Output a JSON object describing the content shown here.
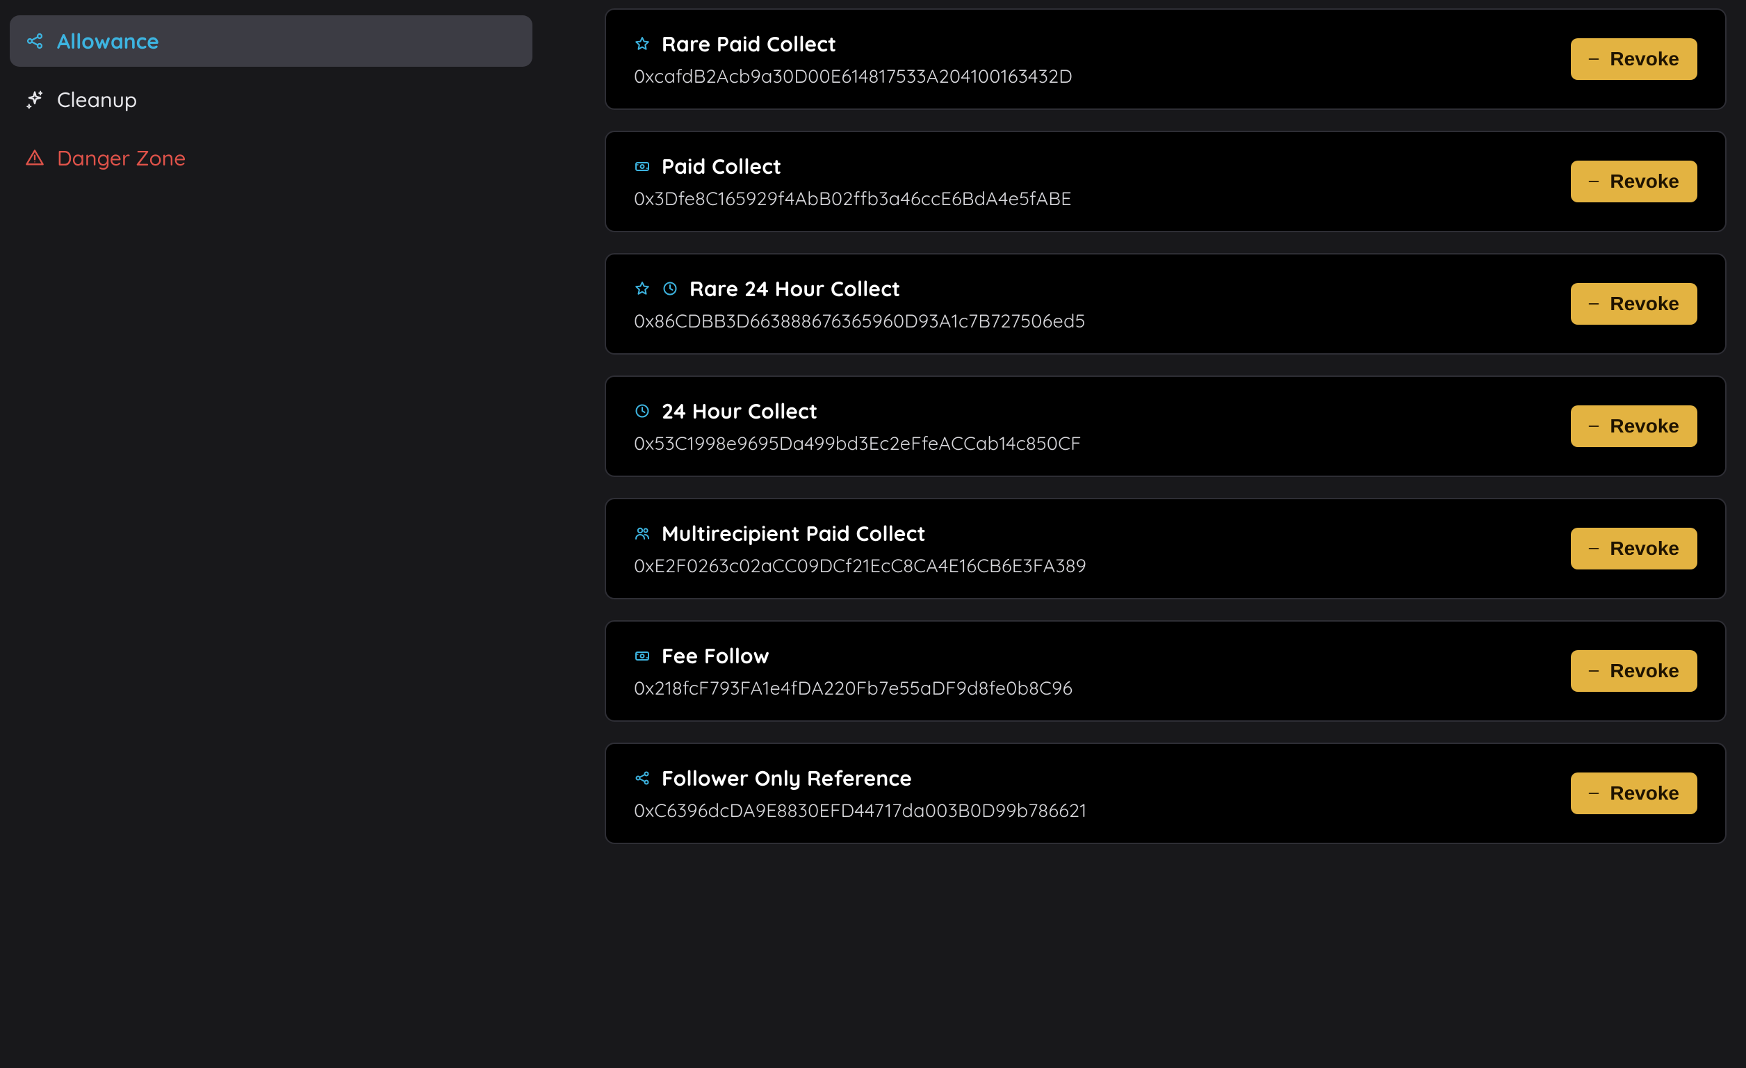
{
  "sidebar": {
    "items": [
      {
        "id": "allowance",
        "label": "Allowance",
        "icon": "share-icon",
        "active": true,
        "danger": false
      },
      {
        "id": "cleanup",
        "label": "Cleanup",
        "icon": "sparkles-icon",
        "active": false,
        "danger": false
      },
      {
        "id": "danger-zone",
        "label": "Danger Zone",
        "icon": "warning-icon",
        "active": false,
        "danger": true
      }
    ]
  },
  "revoke_label": "Revoke",
  "modules": [
    {
      "icons": [
        "star"
      ],
      "title": "Rare Paid Collect",
      "address": "0xcafdB2Acb9a30D00E614817533A204100163432D"
    },
    {
      "icons": [
        "cash"
      ],
      "title": "Paid Collect",
      "address": "0x3Dfe8C165929f4AbB02ffb3a46ccE6BdA4e5fABE"
    },
    {
      "icons": [
        "star",
        "clock"
      ],
      "title": "Rare 24 Hour Collect",
      "address": "0x86CDBB3D663888676365960D93A1c7B727506ed5"
    },
    {
      "icons": [
        "clock"
      ],
      "title": "24 Hour Collect",
      "address": "0x53C1998e9695Da499bd3Ec2eFfeACCab14c850CF"
    },
    {
      "icons": [
        "users"
      ],
      "title": "Multirecipient Paid Collect",
      "address": "0xE2F0263c02aCC09DCf21EcC8CA4E16CB6E3FA389"
    },
    {
      "icons": [
        "cash"
      ],
      "title": "Fee Follow",
      "address": "0x218fcF793FA1e4fDA220Fb7e55aDF9d8fe0b8C96"
    },
    {
      "icons": [
        "share"
      ],
      "title": "Follower Only Reference",
      "address": "0xC6396dcDA9E8830EFD44717da003B0D99b786621"
    }
  ]
}
